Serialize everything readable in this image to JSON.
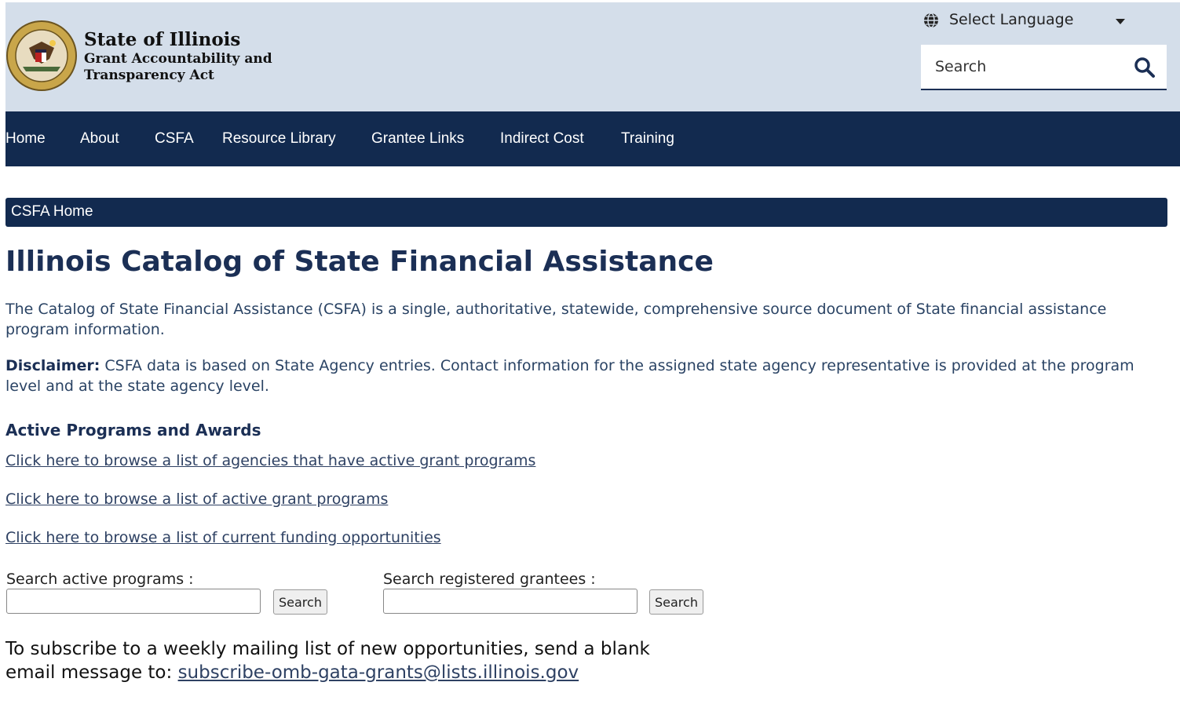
{
  "header": {
    "title": "State of Illinois",
    "subtitle_line1": "Grant Accountability and",
    "subtitle_line2": "Transparency Act",
    "language_label": "Select Language",
    "search_placeholder": "Search"
  },
  "nav": {
    "items": [
      {
        "label": "Home"
      },
      {
        "label": "About"
      },
      {
        "label": "CSFA"
      },
      {
        "label": "Resource Library"
      },
      {
        "label": "Grantee Links"
      },
      {
        "label": "Indirect Cost"
      },
      {
        "label": "Training"
      }
    ]
  },
  "breadcrumb": {
    "label": "CSFA Home"
  },
  "main": {
    "title": "Illinois Catalog of State Financial Assistance",
    "intro": "The Catalog of State Financial Assistance (CSFA) is a single, authoritative, statewide, comprehensive source document of State financial assistance program information.",
    "disclaimer_label": "Disclaimer:",
    "disclaimer_text": " CSFA data is based on State Agency entries. Contact information for the assigned state agency representative is provided at the program level and at the state agency level.",
    "section_title": "Active Programs and Awards",
    "links": [
      {
        "label": "Click here to browse a list of agencies that have active grant programs"
      },
      {
        "label": "Click here to browse a list of active grant programs"
      },
      {
        "label": "Click here to browse a list of current funding opportunities"
      }
    ],
    "search_programs_label": "Search active programs :",
    "search_programs_value": "",
    "search_programs_button": "Search",
    "search_grantees_label": "Search registered grantees :",
    "search_grantees_value": "",
    "search_grantees_button": "Search",
    "subscribe_text_line1": "To subscribe to a weekly mailing list of new opportunities, send a blank",
    "subscribe_text_line2": "email message to: ",
    "subscribe_email": "subscribe-omb-gata-grants@lists.illinois.gov"
  }
}
